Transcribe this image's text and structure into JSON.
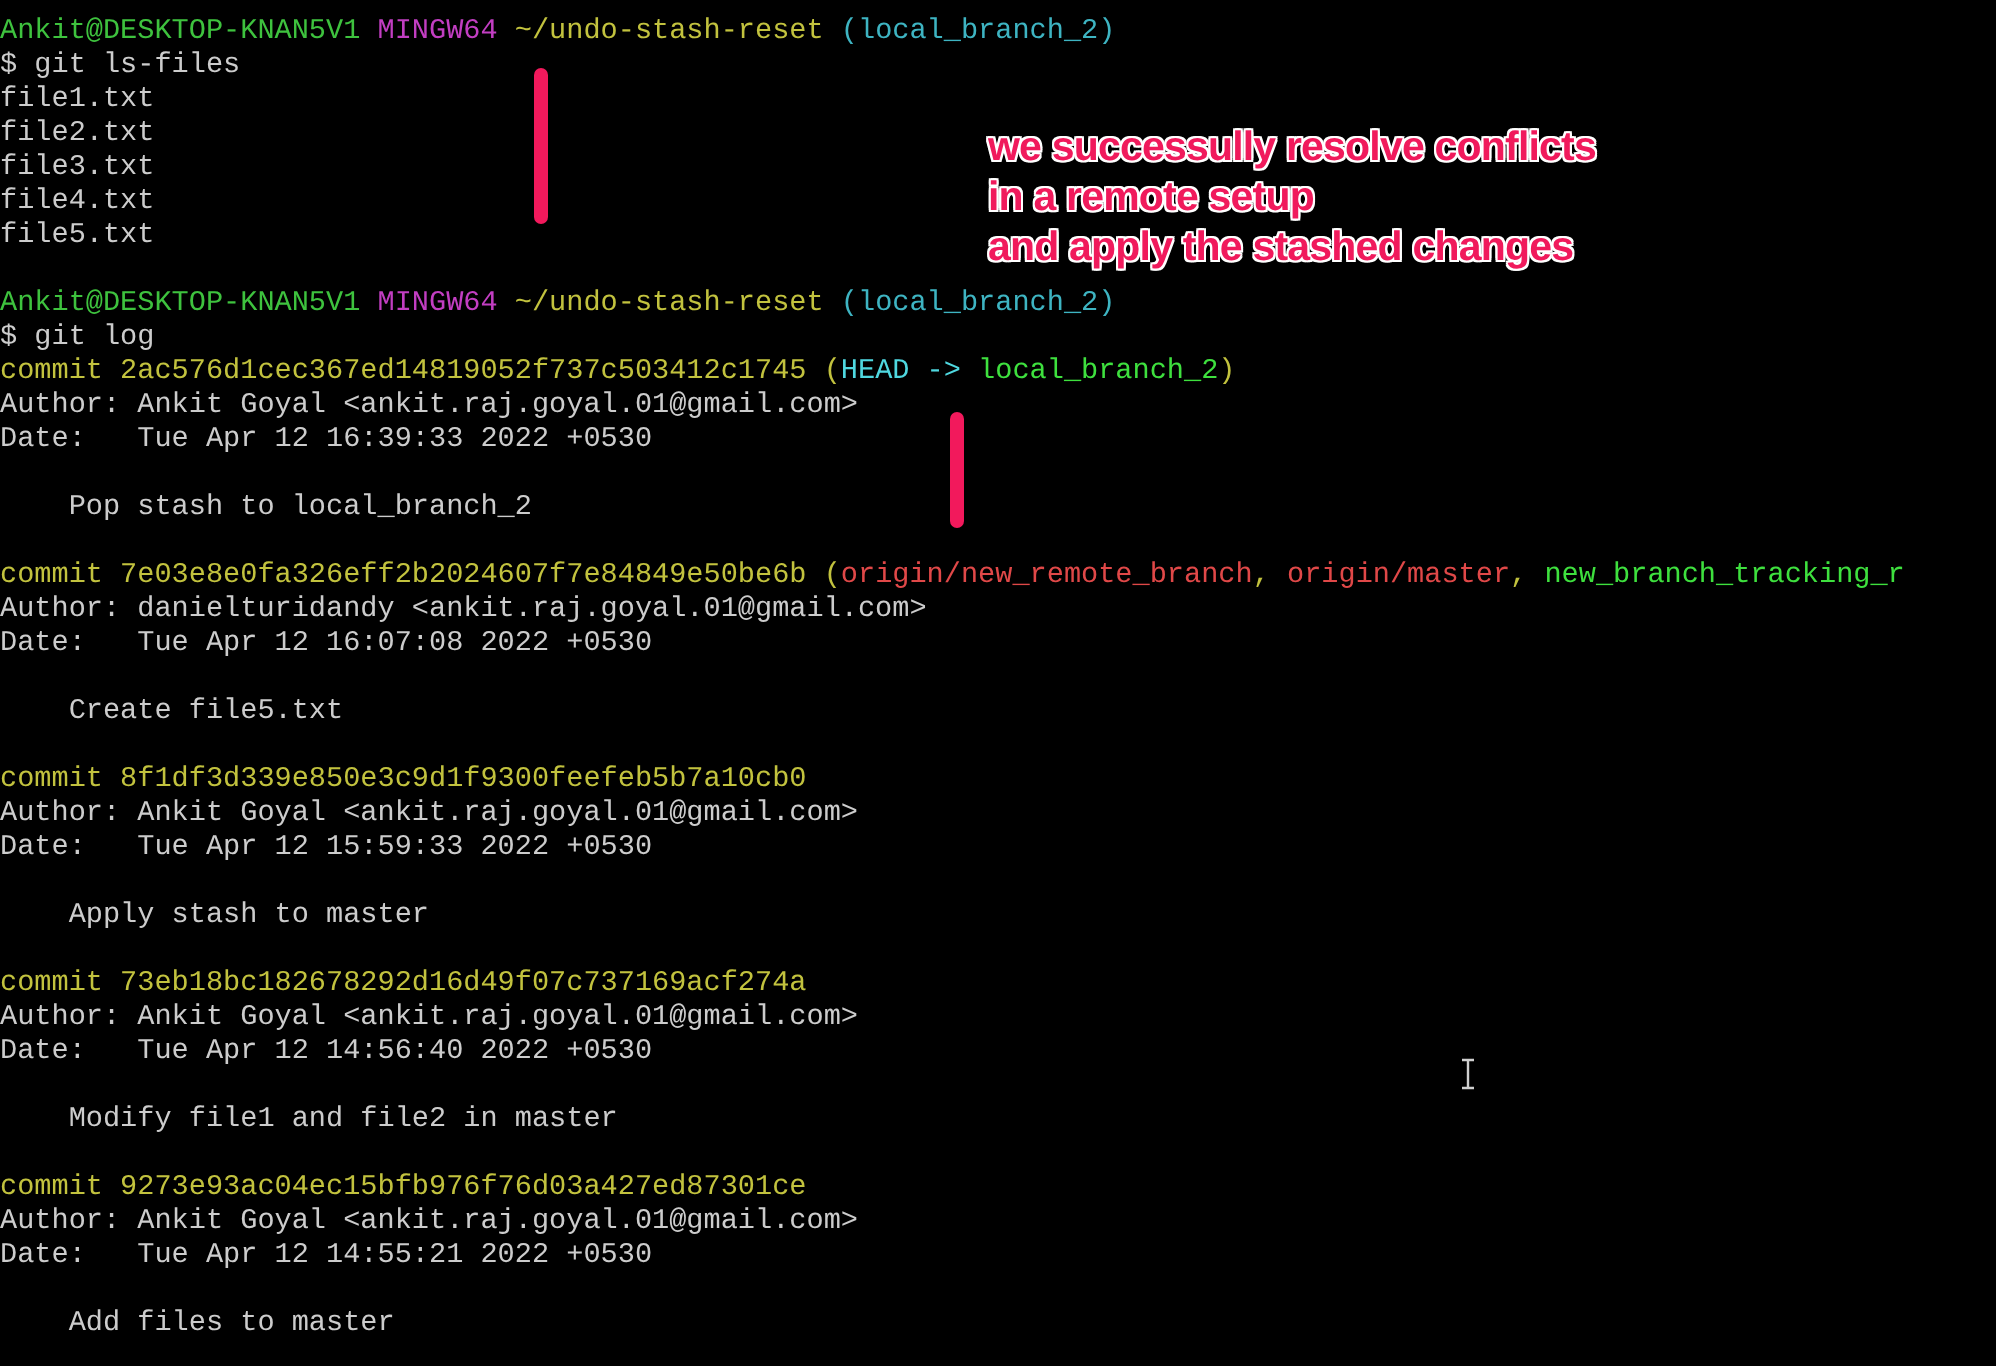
{
  "terminal": {
    "lines": [
      {
        "kind": "text",
        "segments": [
          {
            "kind": "user",
            "text": "Ankit@DESKTOP-KNAN5V1 "
          },
          {
            "kind": "shell",
            "text": "MINGW64 "
          },
          {
            "kind": "path",
            "text": "~/undo-stash-reset "
          },
          {
            "kind": "branch",
            "text": "(local_branch_2)"
          }
        ]
      },
      {
        "kind": "text",
        "segments": [
          {
            "kind": "plain",
            "text": "$ git ls-files"
          }
        ]
      },
      {
        "kind": "text",
        "segments": [
          {
            "kind": "plain",
            "text": "file1.txt"
          }
        ]
      },
      {
        "kind": "text",
        "segments": [
          {
            "kind": "plain",
            "text": "file2.txt"
          }
        ]
      },
      {
        "kind": "text",
        "segments": [
          {
            "kind": "plain",
            "text": "file3.txt"
          }
        ]
      },
      {
        "kind": "text",
        "segments": [
          {
            "kind": "plain",
            "text": "file4.txt"
          }
        ]
      },
      {
        "kind": "text",
        "segments": [
          {
            "kind": "plain",
            "text": "file5.txt"
          }
        ]
      },
      {
        "kind": "blank"
      },
      {
        "kind": "text",
        "segments": [
          {
            "kind": "user",
            "text": "Ankit@DESKTOP-KNAN5V1 "
          },
          {
            "kind": "shell",
            "text": "MINGW64 "
          },
          {
            "kind": "path",
            "text": "~/undo-stash-reset "
          },
          {
            "kind": "branch",
            "text": "(local_branch_2)"
          }
        ]
      },
      {
        "kind": "text",
        "segments": [
          {
            "kind": "plain",
            "text": "$ git log"
          }
        ]
      },
      {
        "kind": "text",
        "segments": [
          {
            "kind": "hash",
            "text": "commit 2ac576d1cec367ed14819052f737c503412c1745 ("
          },
          {
            "kind": "head",
            "text": "HEAD -> "
          },
          {
            "kind": "local",
            "text": "local_branch_2"
          },
          {
            "kind": "hash",
            "text": ")"
          }
        ]
      },
      {
        "kind": "text",
        "segments": [
          {
            "kind": "plain",
            "text": "Author: Ankit Goyal <ankit.raj.goyal.01@gmail.com>"
          }
        ]
      },
      {
        "kind": "text",
        "segments": [
          {
            "kind": "plain",
            "text": "Date:   Tue Apr 12 16:39:33 2022 +0530"
          }
        ]
      },
      {
        "kind": "blank"
      },
      {
        "kind": "text",
        "segments": [
          {
            "kind": "plain",
            "text": "    Pop stash to local_branch_2"
          }
        ]
      },
      {
        "kind": "blank"
      },
      {
        "kind": "text",
        "segments": [
          {
            "kind": "hash",
            "text": "commit 7e03e8e0fa326eff2b2024607f7e84849e50be6b ("
          },
          {
            "kind": "remote",
            "text": "origin/new_remote_branch"
          },
          {
            "kind": "hash",
            "text": ", "
          },
          {
            "kind": "remote",
            "text": "origin/master"
          },
          {
            "kind": "hash",
            "text": ", "
          },
          {
            "kind": "local",
            "text": "new_branch_tracking_r"
          }
        ]
      },
      {
        "kind": "text",
        "segments": [
          {
            "kind": "plain",
            "text": "Author: danielturidandy <ankit.raj.goyal.01@gmail.com>"
          }
        ]
      },
      {
        "kind": "text",
        "segments": [
          {
            "kind": "plain",
            "text": "Date:   Tue Apr 12 16:07:08 2022 +0530"
          }
        ]
      },
      {
        "kind": "blank"
      },
      {
        "kind": "text",
        "segments": [
          {
            "kind": "plain",
            "text": "    Create file5.txt"
          }
        ]
      },
      {
        "kind": "blank"
      },
      {
        "kind": "text",
        "segments": [
          {
            "kind": "hash",
            "text": "commit 8f1df3d339e850e3c9d1f9300feefeb5b7a10cb0"
          }
        ]
      },
      {
        "kind": "text",
        "segments": [
          {
            "kind": "plain",
            "text": "Author: Ankit Goyal <ankit.raj.goyal.01@gmail.com>"
          }
        ]
      },
      {
        "kind": "text",
        "segments": [
          {
            "kind": "plain",
            "text": "Date:   Tue Apr 12 15:59:33 2022 +0530"
          }
        ]
      },
      {
        "kind": "blank"
      },
      {
        "kind": "text",
        "segments": [
          {
            "kind": "plain",
            "text": "    Apply stash to master"
          }
        ]
      },
      {
        "kind": "blank"
      },
      {
        "kind": "text",
        "segments": [
          {
            "kind": "hash",
            "text": "commit 73eb18bc182678292d16d49f07c737169acf274a"
          }
        ]
      },
      {
        "kind": "text",
        "segments": [
          {
            "kind": "plain",
            "text": "Author: Ankit Goyal <ankit.raj.goyal.01@gmail.com>"
          }
        ]
      },
      {
        "kind": "text",
        "segments": [
          {
            "kind": "plain",
            "text": "Date:   Tue Apr 12 14:56:40 2022 +0530"
          }
        ]
      },
      {
        "kind": "blank"
      },
      {
        "kind": "text",
        "segments": [
          {
            "kind": "plain",
            "text": "    Modify file1 and file2 in master"
          }
        ]
      },
      {
        "kind": "blank"
      },
      {
        "kind": "text",
        "segments": [
          {
            "kind": "hash",
            "text": "commit 9273e93ac04ec15bfb976f76d03a427ed87301ce"
          }
        ]
      },
      {
        "kind": "text",
        "segments": [
          {
            "kind": "plain",
            "text": "Author: Ankit Goyal <ankit.raj.goyal.01@gmail.com>"
          }
        ]
      },
      {
        "kind": "text",
        "segments": [
          {
            "kind": "plain",
            "text": "Date:   Tue Apr 12 14:55:21 2022 +0530"
          }
        ]
      },
      {
        "kind": "blank"
      },
      {
        "kind": "text",
        "segments": [
          {
            "kind": "plain",
            "text": "    Add files to master"
          }
        ]
      }
    ]
  },
  "annotation": {
    "lines": [
      "we successully resolve conflicts",
      "in a remote setup",
      "and apply the stashed changes"
    ]
  }
}
